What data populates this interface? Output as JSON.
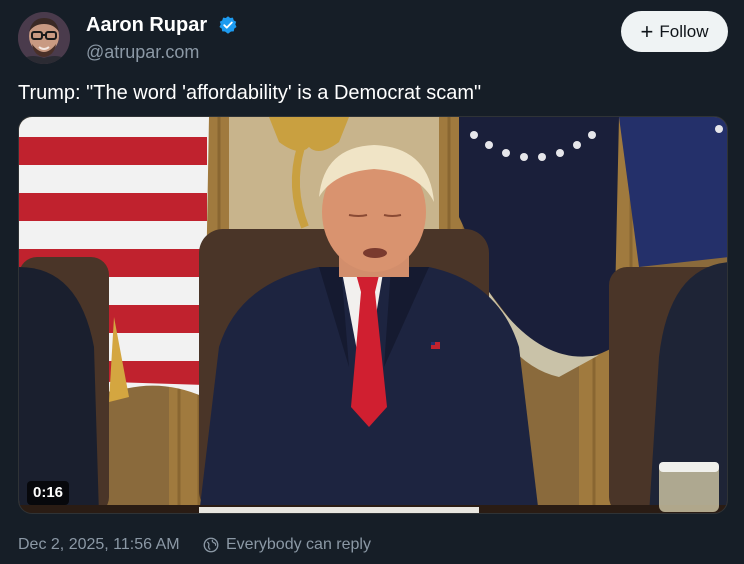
{
  "author": {
    "display_name": "Aaron Rupar",
    "handle": "@atrupar.com",
    "verified_icon": "verified-badge-icon",
    "avatar_icon": "avatar-photo"
  },
  "follow_button": {
    "label": "Follow",
    "icon": "plus-icon"
  },
  "tweet": {
    "text": "Trump: \"The word 'affordability' is a Democrat scam\""
  },
  "media": {
    "type": "video",
    "duration": "0:16"
  },
  "footer": {
    "timestamp": "Dec 2, 2025, 11:56 AM",
    "reply_setting": "Everybody can reply",
    "reply_icon": "globe-icon"
  },
  "colors": {
    "background": "#161e27",
    "primary_text": "#ffffff",
    "secondary_text": "#8b98a5",
    "verified_blue": "#1d9bf0",
    "follow_bg": "#eff3f4"
  }
}
